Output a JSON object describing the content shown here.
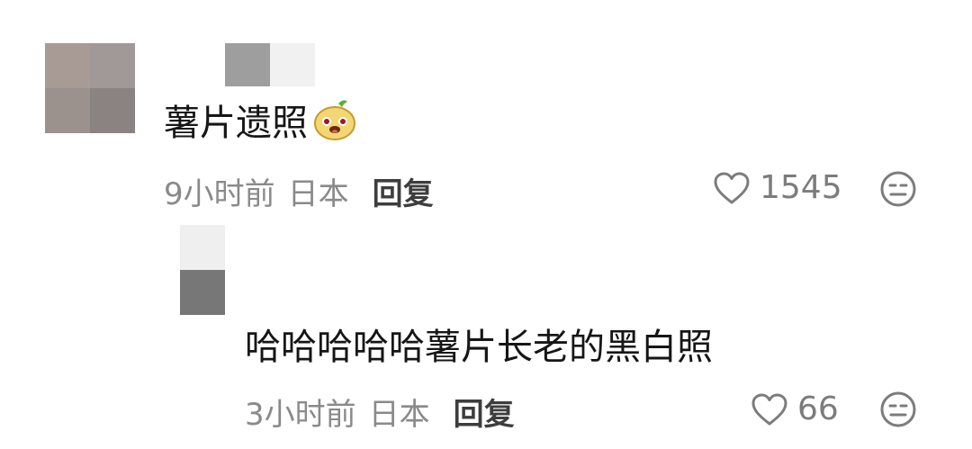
{
  "comments": [
    {
      "text": "薯片遗照",
      "emoji": "potato-chip-emoji",
      "time": "9小时前",
      "location": "日本",
      "reply_label": "回复",
      "likes": "1545",
      "like_icon": "heart-outline-icon",
      "dislike_icon": "neutral-face-icon"
    },
    {
      "text": "哈哈哈哈哈薯片长老的黑白照",
      "time": "3小时前",
      "location": "日本",
      "reply_label": "回复",
      "likes": "66",
      "like_icon": "heart-outline-icon",
      "dislike_icon": "neutral-face-icon"
    }
  ],
  "colors": {
    "text": "#161616",
    "meta": "#8a8a8a",
    "reply_btn": "#3d3d3d",
    "icon": "#7c7c7c"
  }
}
